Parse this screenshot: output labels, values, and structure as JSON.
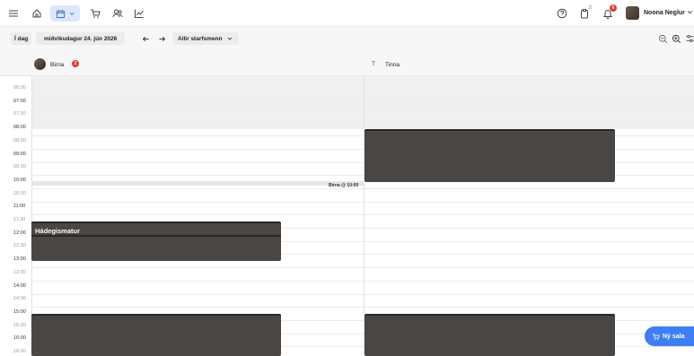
{
  "topbar": {
    "icons": [
      "menu-icon",
      "home-icon",
      "calendar-icon",
      "cart-icon",
      "users-icon",
      "chart-icon",
      "help-icon",
      "clipboard-icon",
      "bell-icon"
    ],
    "clipboard_count": "2",
    "bell_count": "6",
    "user_name": "Noona Neglur"
  },
  "toolbar": {
    "today_label": "Í dag",
    "date_label": "miðvikudagur 24. jún 2026",
    "staff_filter": "Allir starfsmenn"
  },
  "staff": [
    {
      "name": "Birna",
      "badge": "2"
    },
    {
      "name": "Tinna",
      "initial": "T"
    }
  ],
  "times": [
    "06:30",
    "07:00",
    "07:30",
    "08:00",
    "08:30",
    "09:00",
    "09:30",
    "10:00",
    "10:30",
    "11:00",
    "11:30",
    "12:00",
    "12:30",
    "13:00",
    "13:30",
    "14:00",
    "14:30",
    "15:00",
    "15:30",
    "16:00",
    "16:30"
  ],
  "events": {
    "lunch_label": "Hádegismatur",
    "now_marker": "Birna @ 10:00"
  },
  "fab_label": "Ný sala",
  "colors": {
    "accent": "#3d7ff0",
    "block": "#4a4644",
    "badge": "#e23b2e"
  }
}
